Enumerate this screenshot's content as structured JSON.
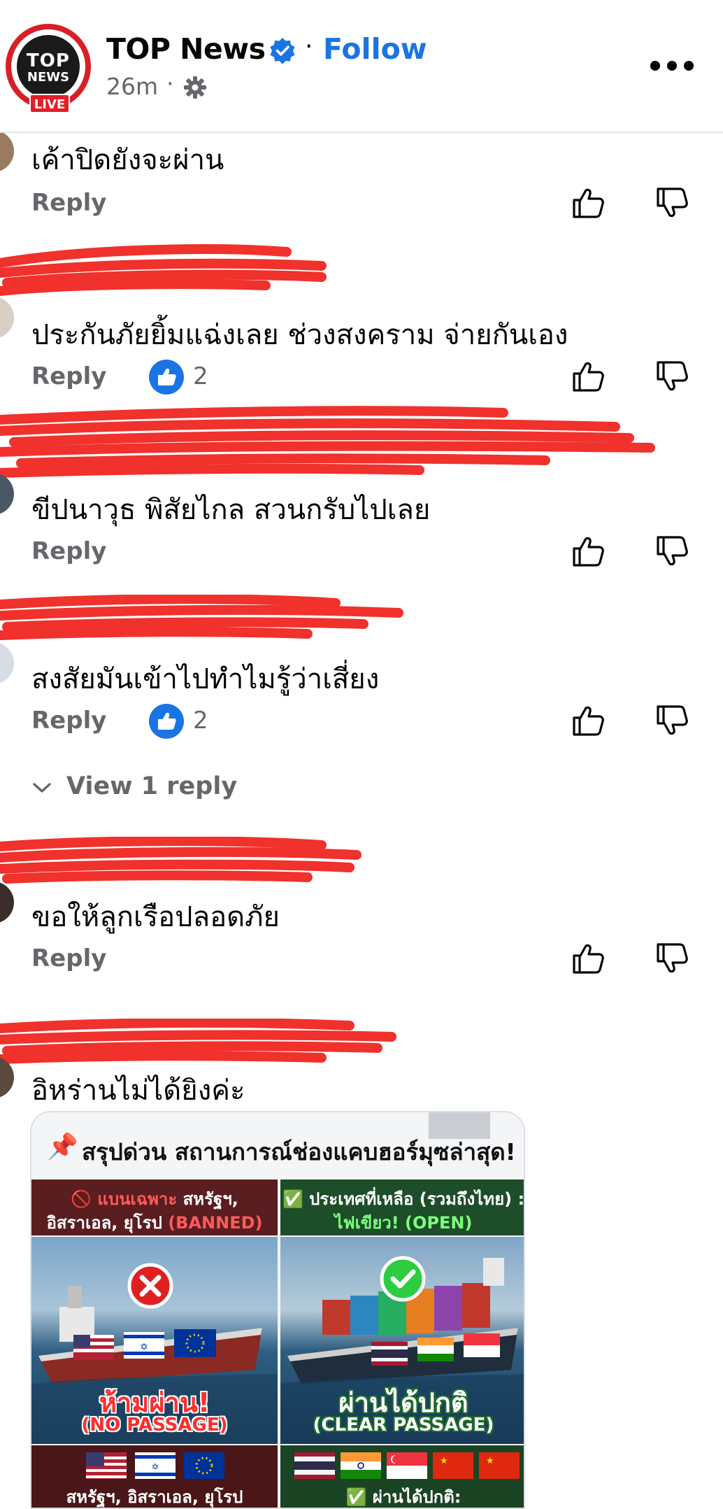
{
  "header": {
    "logo_top": "TOP",
    "logo_news": "NEWS",
    "logo_live": "LIVE",
    "page_name": "TOP News",
    "separator": "·",
    "follow_label": "Follow",
    "time": "26m",
    "time_separator": "·",
    "icons": [
      "verified-badge-icon",
      "gear-icon",
      "more-options-icon"
    ]
  },
  "comments": [
    {
      "text": "เค้าปิดยังจะผ่าน",
      "reply_label": "Reply",
      "reactions": null
    },
    {
      "text": "ประกันภัยยิ้มแฉ่งเลย ช่วงสงคราม จ่ายกันเอง",
      "reply_label": "Reply",
      "reactions": "2"
    },
    {
      "text": "ขีปนาวุธ พิสัยไกล สวนกรับไปเลย",
      "reply_label": "Reply",
      "reactions": null
    },
    {
      "text": "สงสัยมันเข้าไปทำไมรู้ว่าเสี่ยง",
      "reply_label": "Reply",
      "reactions": "2"
    },
    {
      "text": "ขอให้ลูกเรือปลอดภัย",
      "reply_label": "Reply",
      "reactions": null
    },
    {
      "text": "อิหร่านไม่ได้ยิงค่ะ",
      "reply_label": null,
      "reactions": null
    }
  ],
  "view_replies": "View 1 reply",
  "attachment": {
    "pin": "📌",
    "title": "สรุปด่วน สถานการณ์ช่องแคบฮอร์มุซล่าสุด!",
    "left": {
      "head_line1_prefix": "🚫 แบนเฉพาะ",
      "head_line1_rest": " สหรัฐฯ,",
      "head_line2": "อิสราเอล, ยุโรป ",
      "head_line2_tag": "(BANNED)",
      "label_main": "ห้ามผ่าน!",
      "label_sub": "(NO PASSAGE)",
      "foot_text": "สหรัฐฯ, อิสราเอล, ยุโรป"
    },
    "right": {
      "head_line1": "✅ ประเทศที่เหลือ (รวมถึงไทย) :",
      "head_line2": "ไฟเขียว! (OPEN)",
      "label_main": "ผ่านได้ปกติ",
      "label_sub": "(CLEAR PASSAGE)",
      "foot_text": "✅ ผ่านได้ปกติ:"
    }
  },
  "colors": {
    "brand_blue": "#1b74e4",
    "secondary_text": "#65676b",
    "primary_text": "#050505",
    "redaction": "#f0312c"
  }
}
